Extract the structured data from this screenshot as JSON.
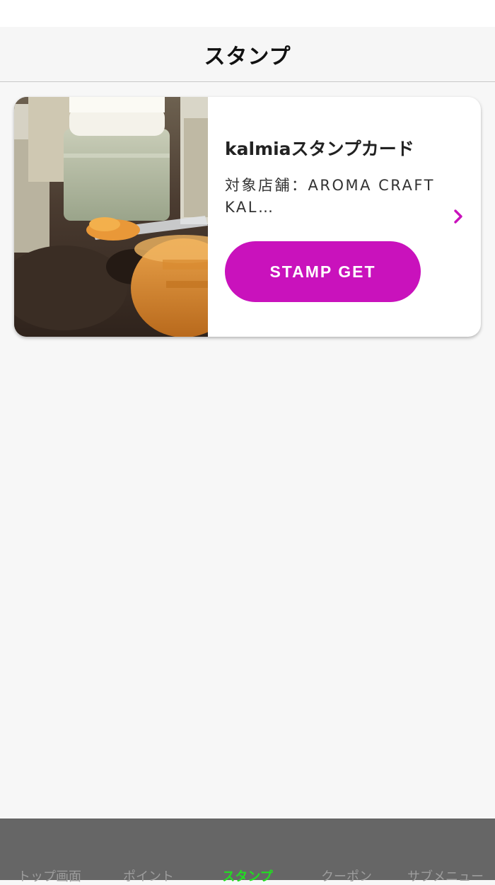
{
  "header": {
    "title": "スタンプ"
  },
  "card": {
    "title": "kalmiaスタンプカード",
    "store": "対象店舗：AROMA CRAFT KAL…",
    "button_label": "STAMP GET",
    "image_description_icon": "photo-jars-and-spatula"
  },
  "tabs": [
    {
      "label": "トップ画面",
      "active": false
    },
    {
      "label": "ポイント",
      "active": false
    },
    {
      "label": "スタンプ",
      "active": true
    },
    {
      "label": "クーポン",
      "active": false
    },
    {
      "label": "サブメニュー",
      "active": false
    }
  ],
  "colors": {
    "accent": "#c912bc",
    "tab_active": "#22dd22",
    "tab_bar": "#666666"
  }
}
